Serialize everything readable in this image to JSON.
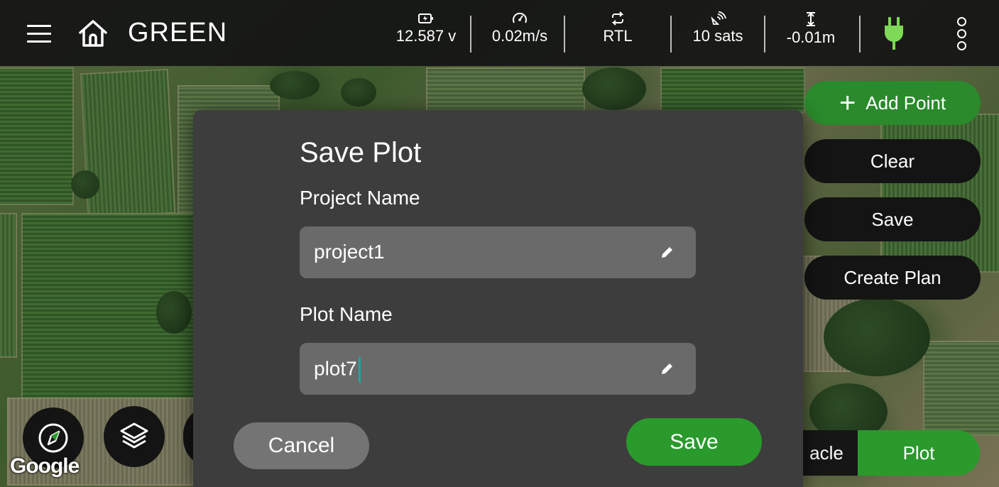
{
  "app": {
    "title": "GREEN"
  },
  "status_bar": {
    "battery": {
      "value": "12.587 v",
      "icon": "battery-icon"
    },
    "speed": {
      "value": "0.02m/s",
      "icon": "speedometer-icon"
    },
    "mode": {
      "value": "RTL",
      "icon": "repeat-icon"
    },
    "gps": {
      "value": "10 sats",
      "icon": "satellite-icon"
    },
    "altitude": {
      "value": "-0.01m",
      "icon": "altitude-icon"
    },
    "connection": {
      "icon": "plug-icon",
      "color": "#7ed957"
    }
  },
  "side_panel": {
    "add_point": "Add Point",
    "clear": "Clear",
    "save": "Save",
    "create_plan": "Create Plan"
  },
  "mode_toggle": {
    "options": [
      "acle",
      "Plot"
    ],
    "selected": "Plot"
  },
  "map": {
    "attribution": "Google"
  },
  "dialog": {
    "title": "Save Plot",
    "project_label": "Project Name",
    "project_value": "project1",
    "plot_label": "Plot Name",
    "plot_value": "plot7",
    "cancel": "Cancel",
    "save": "Save"
  },
  "colors": {
    "accent_green": "#2a9a2c",
    "dialog_bg": "#3d3d3d",
    "topbar_bg": "#141414",
    "caret": "#1aa7a0"
  }
}
